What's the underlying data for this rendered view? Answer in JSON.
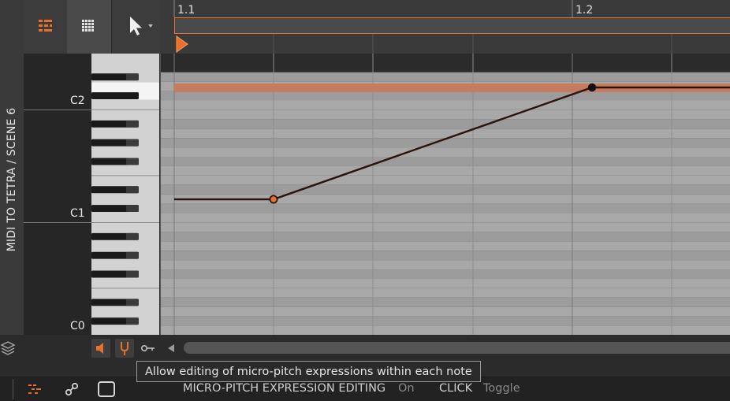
{
  "track_title": "MIDI TO TETRA / SCENE 6",
  "ruler": {
    "marker_1": "1.1",
    "marker_2": "1.2"
  },
  "keyboard": {
    "labels": [
      "C2",
      "C1",
      "C0"
    ]
  },
  "tooltip": "Allow editing of micro-pitch expressions within each note",
  "status": {
    "mode": "MICRO-PITCH EXPRESSION EDITING",
    "state": "On",
    "action": "CLICK",
    "action_result": "Toggle"
  },
  "icons": {
    "toolbar": [
      "note-lanes-icon",
      "grid-icon",
      "pointer-tool-icon"
    ],
    "subbar": [
      "speaker-icon",
      "tuning-fork-icon",
      "key-icon",
      "scroll-left-icon"
    ],
    "status": [
      "layers-icon",
      "note-layout-icon",
      "link-icon",
      "square-icon"
    ]
  },
  "colors": {
    "accent": "#e8702a",
    "note": "#c77a5e",
    "curve": "#2a150c"
  }
}
